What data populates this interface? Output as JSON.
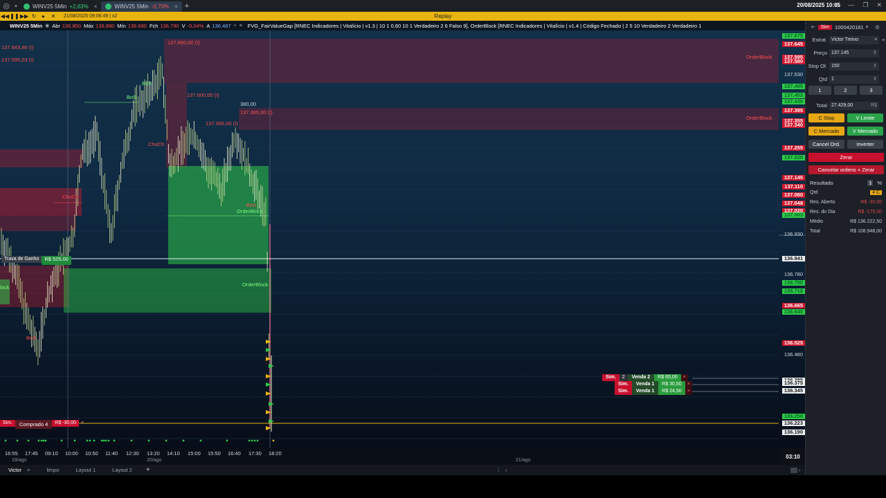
{
  "titlebar": {
    "tabs": [
      {
        "name": "WINV25 5Min",
        "change": "+2,63%",
        "dir": "up",
        "active": false
      },
      {
        "name": "WINV25 5Min",
        "change": "-0,70%",
        "dir": "down",
        "active": true
      }
    ],
    "clock": "20/08/2025 10:05"
  },
  "replay": {
    "time": "21/08/2025 09:06:49 | x2",
    "title": "Replay"
  },
  "infobar": {
    "symbol": "WINV25 5Min",
    "abr_label": "Abr",
    "abr": "136.850",
    "max_label": "Máx",
    "max": "136.880",
    "min_label": "Mín",
    "min": "136.680",
    "fch_label": "Fch",
    "fch": "136.790",
    "var_label": "V",
    "var": "-0,04%",
    "a_label": "A",
    "a": "136.487",
    "indicators": "FVG_FairValueGap [RNEC Indicadores | Vitalício | v1.3 | 10 1 0.60 10 1   Verdadeiro 2 6 Falso 9], OrderBlock [RNEC Indicadores | Vitalício | v1.4 | Código Fechado | 2 5 10 Verdadeiro 2 Verdadeiro 1"
  },
  "chart": {
    "zone_labels": [
      {
        "text": "137.643,46 (I)",
        "color": "#ff4d4d"
      },
      {
        "text": "137.595,03 (I)",
        "color": "#ff4d4d"
      },
      {
        "text": "137.660,00 (I)",
        "color": "#ff4d4d"
      },
      {
        "text": "OrderBlock",
        "color": "#ff4d4d"
      },
      {
        "text": "137.600,00 (I)",
        "color": "#ff4d4d"
      },
      {
        "text": "380,00",
        "color": "#cfd6de"
      },
      {
        "text": "137.365,00 (I)",
        "color": "#ff4d4d"
      },
      {
        "text": "137.395,00 (I)",
        "color": "#ff4d4d"
      },
      {
        "text": "OrderBlock",
        "color": "#ff4d4d"
      },
      {
        "text": "BoS",
        "color": "#7dff7d"
      },
      {
        "text": "BoS",
        "color": "#7dff7d"
      },
      {
        "text": "ChoCh",
        "color": "#ff4d4d"
      },
      {
        "text": "ChoCh",
        "color": "#ff4d4d"
      },
      {
        "text": "BoS",
        "color": "#ff4d4d"
      },
      {
        "text": "OrderBlock",
        "color": "#7dff7d"
      },
      {
        "text": "OrderBlock",
        "color": "#7dff7d"
      },
      {
        "text": "lock",
        "color": "#7dff7d"
      },
      {
        "text": "BoS",
        "color": "#ff4d4d"
      }
    ],
    "trava": {
      "label": "Trava de Ganho",
      "value": "R$ 525,00"
    },
    "position": {
      "sim": "Sim.",
      "label": "Comprado 4",
      "value": "R$ -30,00",
      "close": "×"
    },
    "sells": [
      {
        "sim": "Sim.",
        "qty": "2",
        "name": "Venda 2",
        "result": "R$ 65,00",
        "close": "×"
      },
      {
        "sim": "Sim.",
        "qty": "",
        "name": "Venda 1",
        "result": "R$ 30,50",
        "close": "×"
      },
      {
        "sim": "Sim.",
        "qty": "",
        "name": "Venda 1",
        "result": "R$ 24,50",
        "close": "×"
      }
    ],
    "price_labels": [
      {
        "text": "137.675",
        "style": "green"
      },
      {
        "text": "137.645",
        "style": "red"
      },
      {
        "text": "137.595",
        "style": "red"
      },
      {
        "text": "137.580",
        "style": "red"
      },
      {
        "text": "137.530",
        "style": "plain"
      },
      {
        "text": "137.485",
        "style": "green"
      },
      {
        "text": "137.453",
        "style": "green"
      },
      {
        "text": "137.430",
        "style": "green"
      },
      {
        "text": "137.395",
        "style": "red"
      },
      {
        "text": "137.355",
        "style": "red"
      },
      {
        "text": "137.340",
        "style": "red"
      },
      {
        "text": "137.255",
        "style": "red"
      },
      {
        "text": "137.220",
        "style": "green"
      },
      {
        "text": "137.145",
        "style": "red"
      },
      {
        "text": "137.110",
        "style": "red"
      },
      {
        "text": "137.080",
        "style": "red"
      },
      {
        "text": "137.048",
        "style": "red"
      },
      {
        "text": "137.020",
        "style": "red"
      },
      {
        "text": "137.003",
        "style": "green"
      },
      {
        "text": "136.930",
        "style": "plain"
      },
      {
        "text": "136.841",
        "style": "white"
      },
      {
        "text": "136.780",
        "style": "plain"
      },
      {
        "text": "136.750",
        "style": "green"
      },
      {
        "text": "136.718",
        "style": "green"
      },
      {
        "text": "136.665",
        "style": "red"
      },
      {
        "text": "136.640",
        "style": "green"
      },
      {
        "text": "136.525",
        "style": "red"
      },
      {
        "text": "136.480",
        "style": "plain"
      },
      {
        "text": "136.385",
        "style": "white"
      },
      {
        "text": "136.375",
        "style": "white"
      },
      {
        "text": "136.345",
        "style": "white"
      },
      {
        "text": "136.250",
        "style": "green"
      },
      {
        "text": "136.223",
        "style": "white"
      },
      {
        "text": "136.190",
        "style": "white"
      }
    ]
  },
  "time_axis": {
    "ticks": [
      "16:55",
      "17:45",
      "09:10",
      "10:00",
      "10:50",
      "11:40",
      "12:30",
      "13:20",
      "14:10",
      "15:00",
      "15:50",
      "16:40",
      "17:30",
      "18:20"
    ],
    "dates": [
      "19/ago",
      "20/ago",
      "21/ago"
    ],
    "current": "03:10"
  },
  "workspaces": [
    {
      "label": "Victor",
      "active": true,
      "closable": true
    },
    {
      "label": "limpo",
      "active": false,
      "closable": false
    },
    {
      "label": "Layout 1",
      "active": false,
      "closable": false
    },
    {
      "label": "Layout 2",
      "active": false,
      "closable": false
    }
  ],
  "boleta": {
    "sim": "Sim",
    "account": "1000420181",
    "estrat_label": "Estrat.",
    "estrat": "Victor Treino",
    "preco_label": "Preço",
    "preco": "137.145",
    "stop_label": "Stop Of.",
    "stop": "150",
    "qtd_label": "Qtd",
    "qtd": "1",
    "qty_buttons": [
      "1",
      "2",
      "3"
    ],
    "total_label": "Total",
    "total": "27.429,00",
    "total_suffix": "R$",
    "buttons": {
      "c_stop": "C Stop",
      "v_limite": "V Limite",
      "c_mercado": "C Mercado",
      "v_mercado": "V Mercado",
      "cancel": "Cancel Ord.",
      "inverter": "Inverter",
      "zerar": "Zerar",
      "cancelar_zerar": "Cancelar ordens + Zerar"
    },
    "resultado": {
      "title": "Resultado",
      "dollar": "$",
      "pct": "%",
      "rows": [
        {
          "label": "Qtd",
          "value": "4 C",
          "style": "badge"
        },
        {
          "label": "Res. Aberto",
          "value": "R$ -30,00",
          "style": "neg"
        },
        {
          "label": "Res. do Dia",
          "value": "R$ -175,00",
          "style": "neg"
        },
        {
          "label": "Médio",
          "value": "R$ 136.222,50",
          "style": "plain"
        },
        {
          "label": "Total",
          "value": "R$ 108.948,00",
          "style": "plain"
        }
      ]
    }
  },
  "colors": {
    "accent": "#e8b410",
    "bull": "#2fc94a",
    "bear": "#d0192f"
  }
}
